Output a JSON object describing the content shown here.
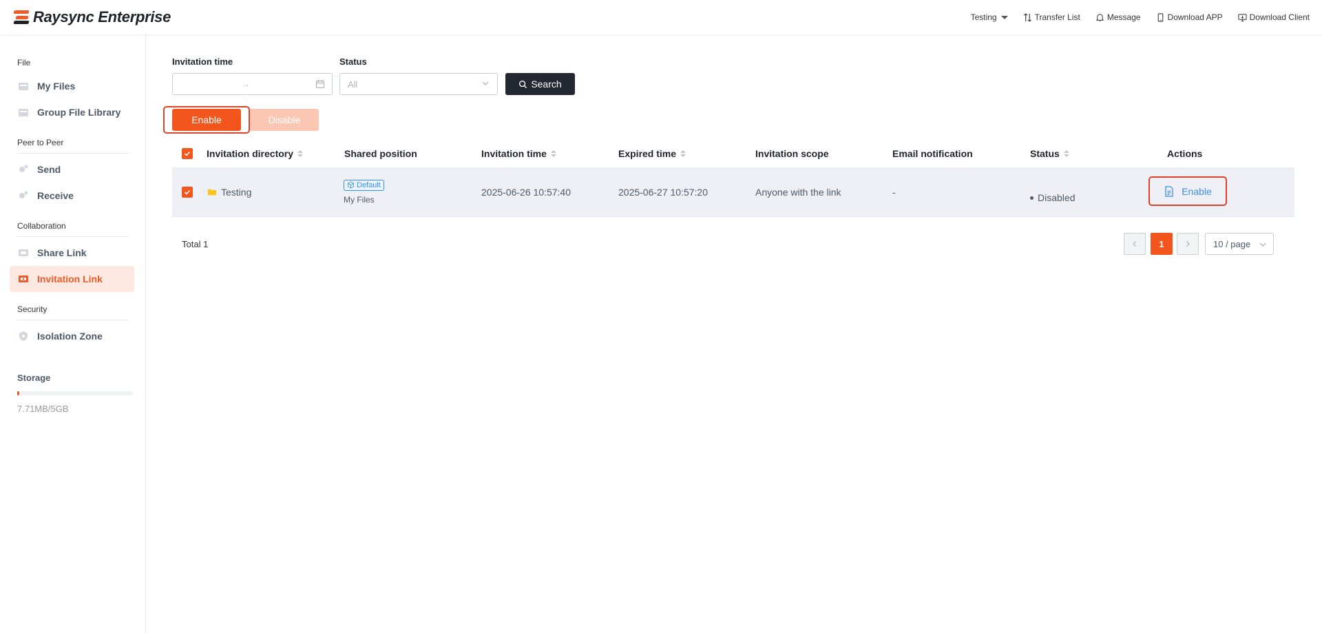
{
  "app": {
    "title": "Raysync Enterprise"
  },
  "header": {
    "user": "Testing",
    "transfer_list": "Transfer List",
    "message": "Message",
    "download_app": "Download APP",
    "download_client": "Download Client"
  },
  "sidebar": {
    "groups": [
      {
        "title": "File",
        "items": [
          "My Files",
          "Group File Library"
        ]
      },
      {
        "title": "Peer to Peer",
        "items": [
          "Send",
          "Receive"
        ]
      },
      {
        "title": "Collaboration",
        "items": [
          "Share Link",
          "Invitation Link"
        ]
      },
      {
        "title": "Security",
        "items": [
          "Isolation Zone"
        ]
      }
    ],
    "active_item": "Invitation Link",
    "storage": {
      "title": "Storage",
      "used_text": "7.71MB/5GB",
      "used_fraction": 0.0015
    }
  },
  "filters": {
    "invitation_time_label": "Invitation time",
    "date_separator": "→",
    "status_label": "Status",
    "status_value": "All",
    "search_label": "Search"
  },
  "bulk": {
    "enable_label": "Enable",
    "disable_label": "Disable"
  },
  "table": {
    "headers": {
      "directory": "Invitation directory",
      "shared_position": "Shared position",
      "invitation_time": "Invitation time",
      "expired_time": "Expired time",
      "scope": "Invitation scope",
      "email": "Email notification",
      "status": "Status",
      "actions": "Actions"
    },
    "rows": [
      {
        "directory": "Testing",
        "badge": "Default",
        "shared_position": "My Files",
        "invitation_time": "2025-06-26 10:57:40",
        "expired_time": "2025-06-27 10:57:20",
        "scope": "Anyone with the link",
        "email": "-",
        "status": "Disabled",
        "action": "Enable"
      }
    ]
  },
  "pagination": {
    "total_text": "Total 1",
    "current_page": "1",
    "per_page": "10 / page"
  },
  "colors": {
    "accent": "#f2561d",
    "link": "#3a8ee6",
    "highlight": "#e0412b",
    "dark_button": "#232732"
  }
}
